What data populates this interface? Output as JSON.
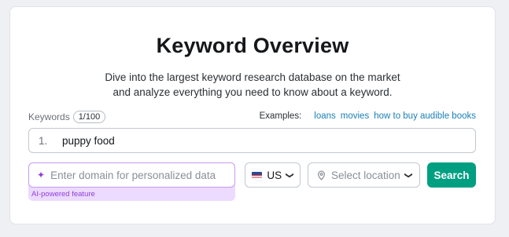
{
  "header": {
    "title": "Keyword Overview",
    "subtitle_line1": "Dive into the largest keyword research database on the market",
    "subtitle_line2": "and analyze everything you need to know about a keyword."
  },
  "keywords": {
    "label": "Keywords",
    "count": "1/100",
    "examples_label": "Examples:",
    "examples": [
      "loans",
      "movies",
      "how to buy audible books"
    ],
    "row_number": "1.",
    "value": "puppy food"
  },
  "domain": {
    "placeholder": "Enter domain for personalized data",
    "caption": "AI-powered feature",
    "icon": "sparkle-icon"
  },
  "country": {
    "selected": "US",
    "flag": "us-flag-icon"
  },
  "location": {
    "placeholder": "Select location",
    "icon": "location-pin-icon"
  },
  "search": {
    "label": "Search"
  },
  "colors": {
    "accent": "#009f81",
    "link": "#1a7fb5",
    "ai_purple": "#8f3fd8",
    "ai_background": "#ecdaff"
  }
}
